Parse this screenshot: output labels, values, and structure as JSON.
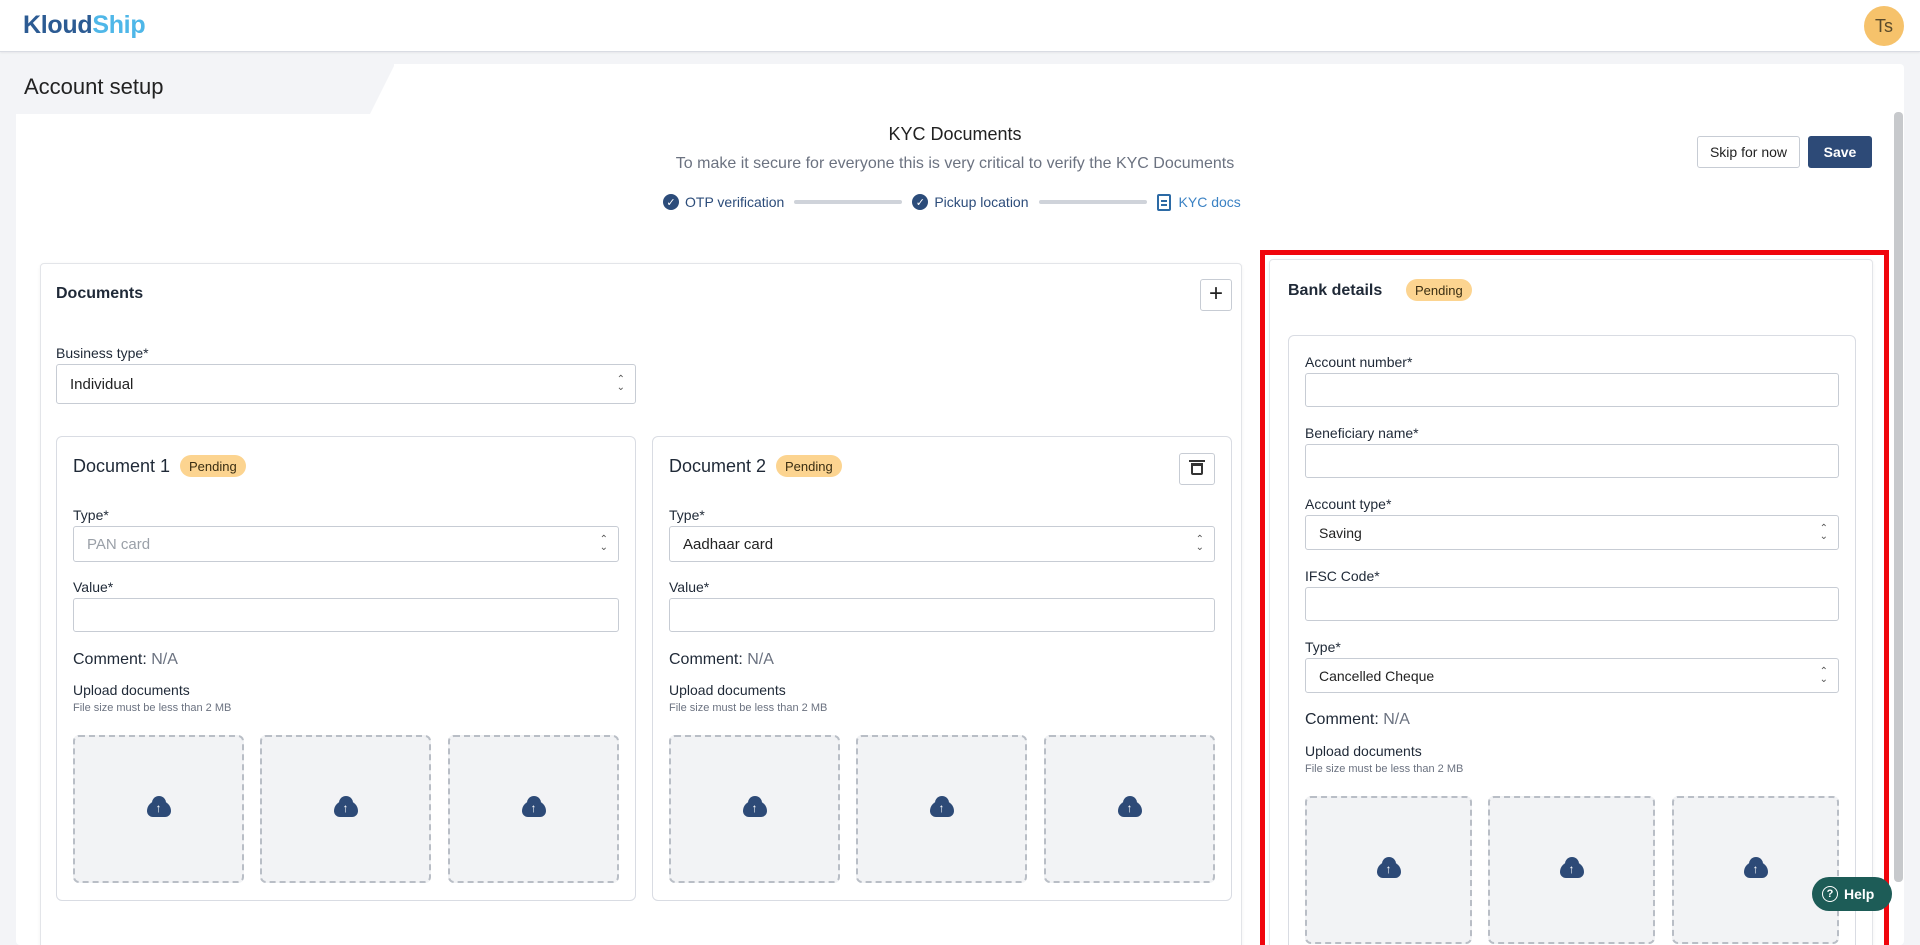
{
  "app": {
    "logo_part1": "Kloud",
    "logo_part2": "Ship",
    "avatar_initials": "Ts"
  },
  "page": {
    "title": "Account setup"
  },
  "kyc": {
    "title": "KYC Documents",
    "subtitle": "To make it secure for everyone this is very critical to verify the KYC Documents",
    "steps": [
      {
        "label": "OTP verification",
        "status": "done"
      },
      {
        "label": "Pickup location",
        "status": "done"
      },
      {
        "label": "KYC docs",
        "status": "active"
      }
    ]
  },
  "actions": {
    "skip_label": "Skip for now",
    "save_label": "Save"
  },
  "documents": {
    "title": "Documents",
    "business_type_label": "Business type*",
    "business_type_value": "Individual",
    "items": [
      {
        "name": "Document 1",
        "status": "Pending",
        "type_label": "Type*",
        "type_value": "PAN card",
        "value_label": "Value*",
        "value": "",
        "comment_label": "Comment:",
        "comment_value": "N/A",
        "upload_title": "Upload documents",
        "upload_hint": "File size must be less than 2 MB"
      },
      {
        "name": "Document 2",
        "status": "Pending",
        "type_label": "Type*",
        "type_value": "Aadhaar card",
        "value_label": "Value*",
        "value": "",
        "comment_label": "Comment:",
        "comment_value": "N/A",
        "upload_title": "Upload documents",
        "upload_hint": "File size must be less than 2 MB"
      }
    ]
  },
  "bank": {
    "title": "Bank details",
    "status": "Pending",
    "account_number_label": "Account number*",
    "account_number": "",
    "beneficiary_label": "Beneficiary name*",
    "beneficiary": "",
    "account_type_label": "Account type*",
    "account_type_value": "Saving",
    "ifsc_label": "IFSC Code*",
    "ifsc": "",
    "type_label": "Type*",
    "type_value": "Cancelled Cheque",
    "comment_label": "Comment:",
    "comment_value": "N/A",
    "upload_title": "Upload documents",
    "upload_hint": "File size must be less than 2 MB"
  },
  "help": {
    "label": "Help"
  },
  "colors": {
    "primary": "#2d4a77",
    "accent": "#4fb7e8",
    "badge": "#fcd490",
    "highlight": "#f0050c",
    "help": "#1d5c57"
  }
}
